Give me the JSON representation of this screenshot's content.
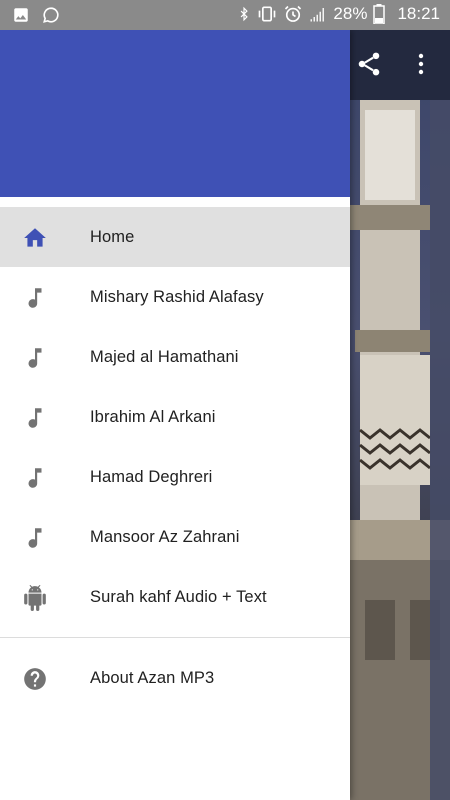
{
  "status_bar": {
    "battery": "28%",
    "time": "18:21"
  },
  "drawer": {
    "menu": [
      {
        "label": "Home",
        "icon": "home-icon",
        "active": true
      },
      {
        "label": "Mishary Rashid Alafasy",
        "icon": "music-note-icon"
      },
      {
        "label": "Majed al Hamathani",
        "icon": "music-note-icon"
      },
      {
        "label": "Ibrahim Al Arkani",
        "icon": "music-note-icon"
      },
      {
        "label": "Hamad Deghreri",
        "icon": "music-note-icon"
      },
      {
        "label": "Mansoor Az Zahrani",
        "icon": "music-note-icon"
      },
      {
        "label": "Surah kahf Audio + Text",
        "icon": "android-icon"
      }
    ],
    "secondary": [
      {
        "label": "About Azan MP3",
        "icon": "help-icon"
      }
    ]
  },
  "colors": {
    "primary": "#3f51b5",
    "active_row": "#e0e0e0",
    "status_bar": "#8a8a8a"
  }
}
